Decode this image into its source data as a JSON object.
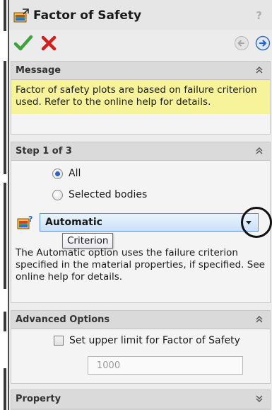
{
  "window": {
    "title": "Factor of Safety",
    "help_glyph": "?"
  },
  "actions": {
    "ok_icon": "checkmark-icon",
    "cancel_icon": "x-icon",
    "back_icon": "back-arrow-icon",
    "next_icon": "next-arrow-icon"
  },
  "message": {
    "header": "Message",
    "text": "Factor of safety plots are based on failure criterion used. Refer to the online help for details.",
    "background_color": "#f7f39a"
  },
  "step": {
    "header": "Step 1 of 3",
    "radios": [
      {
        "label": "All",
        "selected": true
      },
      {
        "label": "Selected bodies",
        "selected": false
      }
    ],
    "criterion_value": "Automatic",
    "tooltip": "Criterion",
    "description": "The Automatic option uses the failure criterion specified in the material properties, if specified. See online help for details."
  },
  "advanced": {
    "header": "Advanced Options",
    "checkbox_label": "Set upper limit for Factor of Safety",
    "checkbox_checked": false,
    "limit_value": "1000"
  },
  "property": {
    "header": "Property"
  },
  "colors": {
    "accent_blue": "#2a63c2",
    "ok_green": "#3ca33c",
    "cancel_red": "#d0201e"
  }
}
